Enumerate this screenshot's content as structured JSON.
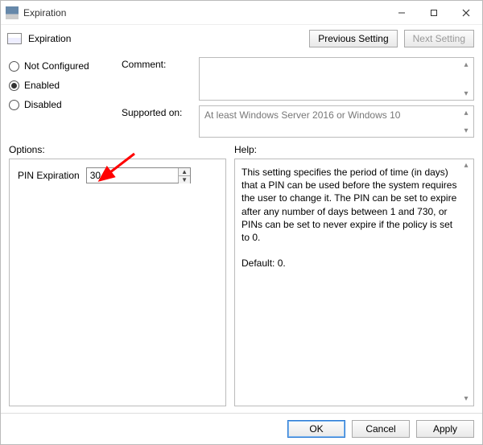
{
  "window": {
    "title": "Expiration"
  },
  "header": {
    "title": "Expiration",
    "prev_btn": "Previous Setting",
    "next_btn": "Next Setting"
  },
  "state": {
    "not_configured": "Not Configured",
    "enabled": "Enabled",
    "disabled": "Disabled",
    "selected": "enabled"
  },
  "fields": {
    "comment_label": "Comment:",
    "comment_value": "",
    "supported_label": "Supported on:",
    "supported_value": "At least Windows Server 2016 or Windows 10"
  },
  "labels": {
    "options": "Options:",
    "help": "Help:"
  },
  "options": {
    "pin_expiration_label": "PIN Expiration",
    "pin_expiration_value": "30"
  },
  "help": {
    "body": "This setting specifies the period of time (in days) that a PIN can be used before the system requires the user to change it. The PIN can be set to expire after any number of days between 1 and 730, or PINs can be set to never expire if the policy is set to 0.",
    "default": "Default: 0."
  },
  "footer": {
    "ok": "OK",
    "cancel": "Cancel",
    "apply": "Apply"
  }
}
